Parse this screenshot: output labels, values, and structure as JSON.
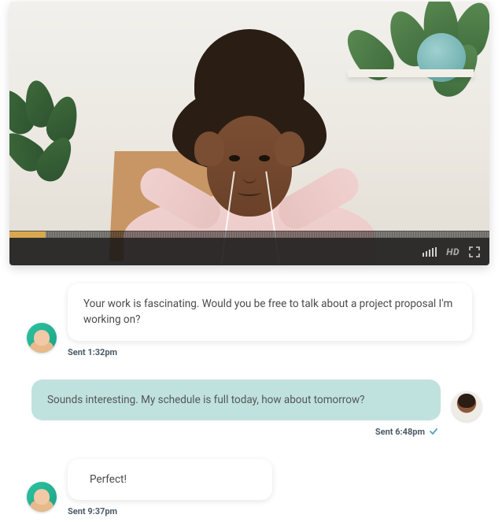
{
  "video": {
    "hd_label": "HD",
    "progress_percent": 7.5,
    "signal_icon": "signal-bars-icon",
    "fullscreen_icon": "fullscreen-icon"
  },
  "chat": {
    "messages": [
      {
        "direction": "outgoing",
        "text": "Your work is fascinating.  Would you be free to talk about a project proposal I'm working on?",
        "meta": "Sent 1:32pm"
      },
      {
        "direction": "incoming",
        "text": "Sounds interesting. My schedule is full today, how about tomorrow?",
        "meta": "Sent 6:48pm",
        "read": true
      },
      {
        "direction": "outgoing",
        "text": "Perfect!",
        "meta": "Sent 9:37pm"
      }
    ]
  }
}
